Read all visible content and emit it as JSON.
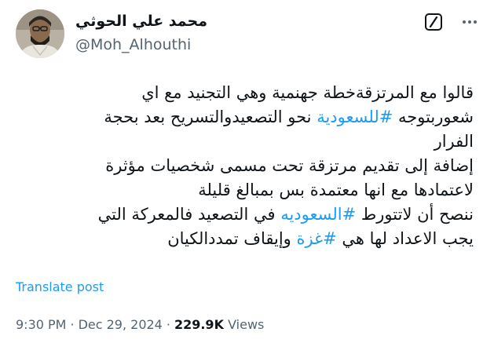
{
  "author": {
    "display_name": "محمد علي الحوثي",
    "handle": "@Moh_Alhouthi"
  },
  "header_actions": {
    "grok_icon": "grok-icon",
    "more_icon": "more-horizontal-icon"
  },
  "tweet": {
    "lines": [
      [
        {
          "text": "قالوا مع المرتزقةخطة جهنمية وهي التجنيد مع اي"
        }
      ],
      [
        {
          "text": "شعوربتوجه "
        },
        {
          "text": "#للسعودية",
          "hashtag": true
        },
        {
          "text": " نحو التصعيدوالتسريح بعد بحجة"
        }
      ],
      [
        {
          "text": "الفرار"
        }
      ],
      [
        {
          "text": "إضافة إلى تقديم مرتزقة تحت مسمى شخصيات مؤثرة"
        }
      ],
      [
        {
          "text": "لاعتمادها مع انها معتمدة بس بمبالغ قليلة"
        }
      ],
      [
        {
          "text": "ننصح أن لاتتورط "
        },
        {
          "text": "#السعوديه",
          "hashtag": true
        },
        {
          "text": " في التصعيد فالمعركة التي"
        }
      ],
      [
        {
          "text": "يجب الاعداد لها هي "
        },
        {
          "text": "#غزة",
          "hashtag": true
        },
        {
          "text": " وإيقاف تمددالكيان"
        }
      ]
    ]
  },
  "translate_label": "Translate post",
  "meta": {
    "time": "9:30 PM",
    "separator": "·",
    "date": "Dec 29, 2024",
    "views_count": "229.9K",
    "views_label": "Views"
  },
  "colors": {
    "text": "#0f1419",
    "secondary": "#536471",
    "link": "#1d9bf0",
    "background": "#ffffff"
  }
}
